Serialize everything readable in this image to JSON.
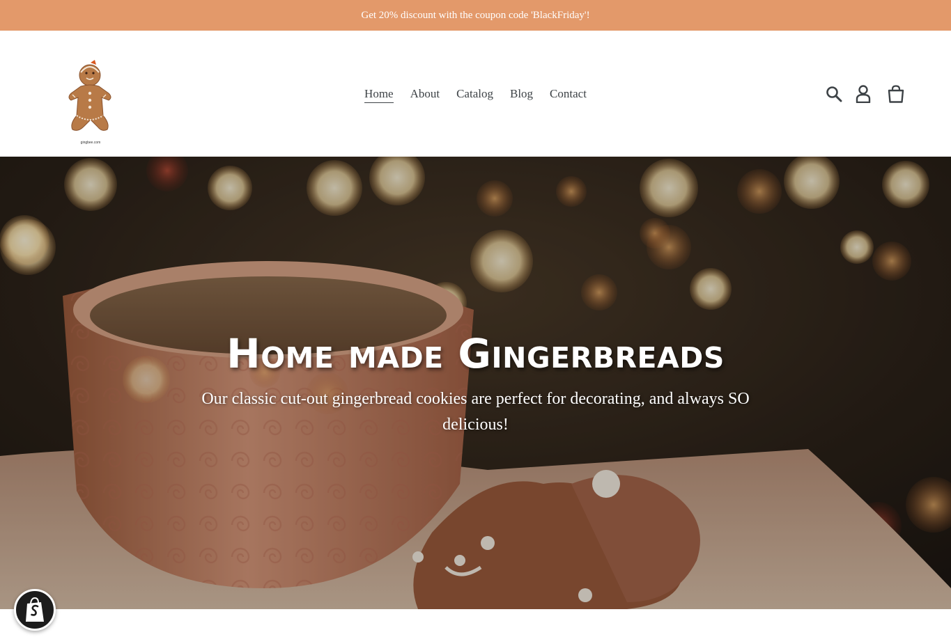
{
  "announcement": {
    "text": "Get 20% discount with the coupon code 'BlackFriday'!",
    "background": "#e3996a"
  },
  "header": {
    "logo": {
      "icon": "gingerbread-man-logo",
      "caption": "gingbee.com"
    },
    "nav": [
      {
        "label": "Home",
        "active": true
      },
      {
        "label": "About",
        "active": false
      },
      {
        "label": "Catalog",
        "active": false
      },
      {
        "label": "Blog",
        "active": false
      },
      {
        "label": "Contact",
        "active": false
      }
    ],
    "icons": [
      "search-icon",
      "account-icon",
      "cart-icon"
    ]
  },
  "hero": {
    "title": "Home made Gingerbreads",
    "subtitle": "Our classic cut-out gingerbread cookies are perfect for decorating, and always SO delicious!",
    "image": "tea-cup-with-gingerbread-cookies-bokeh"
  },
  "floating": {
    "icon": "shopify-bag-icon"
  },
  "colors": {
    "text": "#3d4246",
    "accent": "#e3996a",
    "hero_text": "#ffffff"
  }
}
